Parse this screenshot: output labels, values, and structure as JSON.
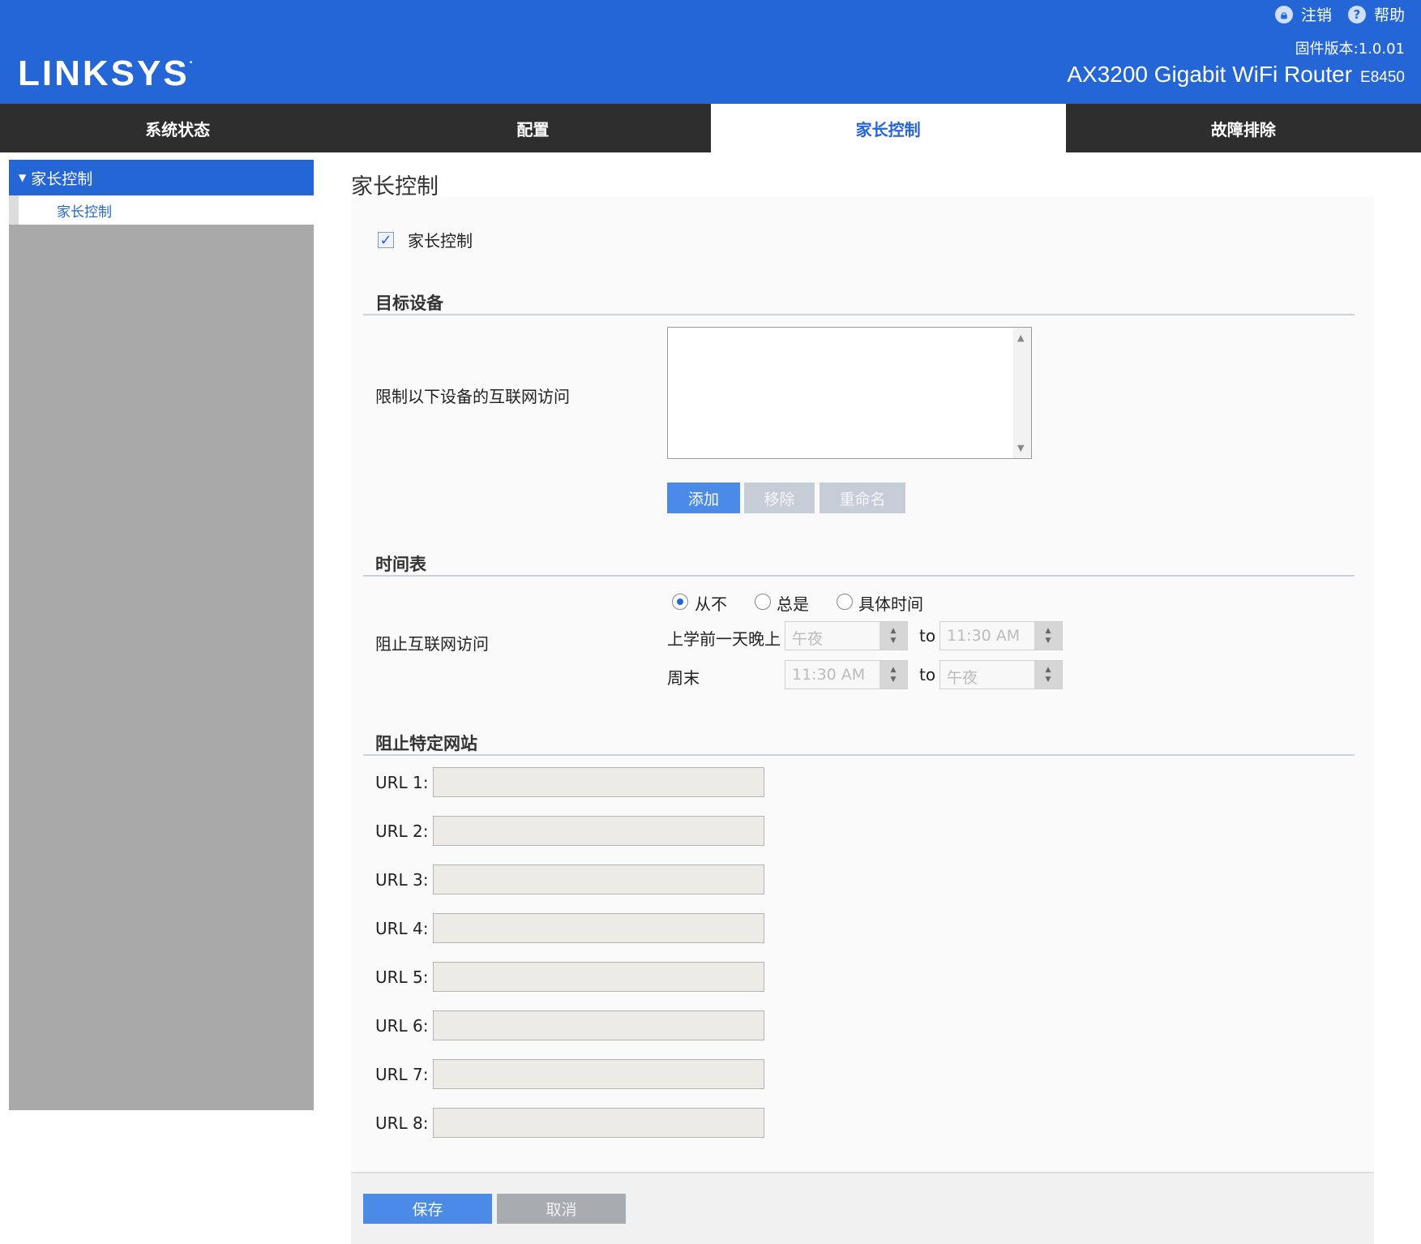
{
  "header": {
    "logo": "LINKSYS",
    "logout_label": "注销",
    "help_label": "帮助",
    "firmware": "固件版本:1.0.01",
    "model_name": "AX3200 Gigabit WiFi Router",
    "model_code": "E8450",
    "colors": {
      "bar": "#2566d6"
    }
  },
  "nav": {
    "tabs": [
      {
        "label": "系统状态"
      },
      {
        "label": "配置"
      },
      {
        "label": "家长控制",
        "active": true
      },
      {
        "label": "故障排除"
      }
    ]
  },
  "sidebar": {
    "section": "家长控制",
    "items": [
      {
        "label": "家长控制"
      }
    ]
  },
  "main": {
    "title": "家长控制",
    "enable_checkbox": {
      "label": "家长控制",
      "checked": true
    },
    "target_devices": {
      "heading": "目标设备",
      "restrict_label": "限制以下设备的互联网访问",
      "buttons": {
        "add": "添加",
        "remove": "移除",
        "rename": "重命名"
      }
    },
    "schedule": {
      "heading": "时间表",
      "block_label": "阻止互联网访问",
      "options": {
        "never": "从不",
        "always": "总是",
        "specific": "具体时间"
      },
      "selected": "从不",
      "school_night_label": "上学前一天晚上",
      "weekend_label": "周末",
      "to_label": "to",
      "school_from": "午夜",
      "school_to": "11:30 AM",
      "weekend_from": "11:30 AM",
      "weekend_to": "午夜"
    },
    "sites": {
      "heading": "阻止特定网站",
      "urls": [
        {
          "label": "URL 1:",
          "value": ""
        },
        {
          "label": "URL 2:",
          "value": ""
        },
        {
          "label": "URL 3:",
          "value": ""
        },
        {
          "label": "URL 4:",
          "value": ""
        },
        {
          "label": "URL 5:",
          "value": ""
        },
        {
          "label": "URL 6:",
          "value": ""
        },
        {
          "label": "URL 7:",
          "value": ""
        },
        {
          "label": "URL 8:",
          "value": ""
        }
      ]
    }
  },
  "footer": {
    "save": "保存",
    "cancel": "取消"
  }
}
